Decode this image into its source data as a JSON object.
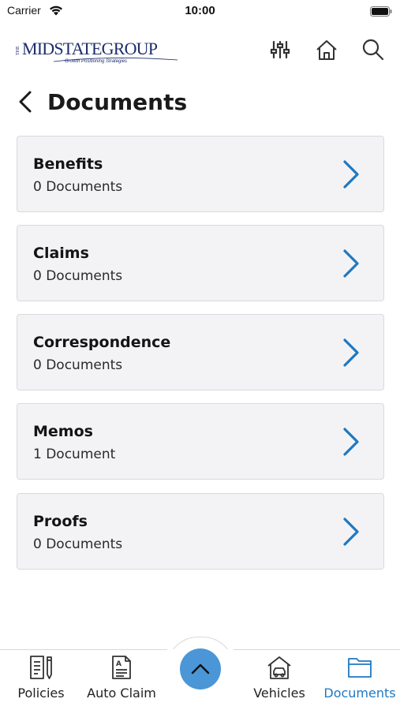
{
  "status_bar": {
    "carrier": "Carrier",
    "time": "10:00"
  },
  "header": {
    "logo": {
      "the": "THE",
      "main": "MIDSTATEGROUP",
      "tagline": "Growth Positioning Strategies"
    },
    "icons": [
      "sliders-icon",
      "home-icon",
      "search-icon"
    ]
  },
  "page": {
    "title": "Documents"
  },
  "documents": [
    {
      "title": "Benefits",
      "count": "0 Documents"
    },
    {
      "title": "Claims",
      "count": "0 Documents"
    },
    {
      "title": "Correspondence",
      "count": "0 Documents"
    },
    {
      "title": "Memos",
      "count": "1 Document"
    },
    {
      "title": "Proofs",
      "count": "0 Documents"
    }
  ],
  "bottom_nav": {
    "items": [
      {
        "label": "Policies",
        "icon": "policy-doc-icon"
      },
      {
        "label": "Auto Claim",
        "icon": "auto-claim-icon"
      },
      {
        "label": "Vehicles",
        "icon": "vehicle-garage-icon"
      },
      {
        "label": "Documents",
        "icon": "folder-icon",
        "active": true
      }
    ]
  },
  "colors": {
    "accent": "#1f78c1",
    "fab": "#4a96d6",
    "card_bg": "#f3f3f5",
    "logo_navy": "#1d2d6b"
  }
}
